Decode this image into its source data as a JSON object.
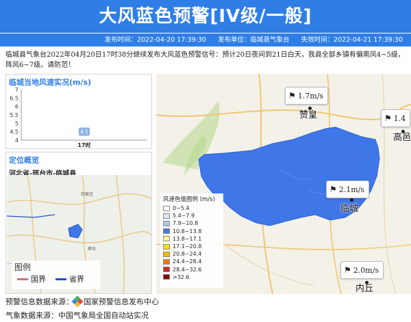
{
  "banner": {
    "title": "大风蓝色预警[IV级/一般]"
  },
  "meta": {
    "publish_label": "发布时间：",
    "publish_time": "2022-04-20 17:39:30",
    "unit_label": "发布单位：",
    "unit": "临城县气象台",
    "expire_label": "失效时间：",
    "expire_time": "2022-04-21 17:39:30"
  },
  "description": "临城县气象台2022年04月20日17时38分继续发布大风蓝色预警信号：预计20日夜间到21日白天，我县全部乡镇有偏南风4~5级，阵风6~7级。请防范！",
  "wind_panel": {
    "title": "临城当地风速实况(m/s)"
  },
  "chart_data": {
    "type": "bar",
    "title": "临城当地风速实况(m/s)",
    "categories": [
      "17时"
    ],
    "values": [
      4.5
    ],
    "value_labels": [
      "4.5"
    ],
    "ylim": [
      4,
      7
    ],
    "yticks": [
      "7",
      "6.5",
      "6",
      "5.5",
      "5",
      "4.5",
      "4"
    ],
    "color": "#8ab0e6"
  },
  "location_panel": {
    "title": "定位概览",
    "path": "河北省-邢台市-临城县",
    "legend_title": "图例",
    "legend_items": [
      {
        "label": "国界",
        "color": "#d07080"
      },
      {
        "label": "省界",
        "color": "#1f4fd1"
      }
    ],
    "map_labels": [
      "石家庄",
      "邢台"
    ]
  },
  "main_map": {
    "region_color": "#3f77e8",
    "stations": [
      {
        "speed": "1.7m/s",
        "name": "赞皇"
      },
      {
        "speed": "1.4",
        "name": "高邑"
      },
      {
        "speed": "2.1m/s",
        "name": "临城"
      },
      {
        "speed": "2.0m/s",
        "name": "内丘"
      }
    ],
    "legend": {
      "title": "风速色值图例 (m/s)",
      "items": [
        {
          "label": "0~5.4",
          "color": "#ffffff"
        },
        {
          "label": "5.4~7.9",
          "color": "#d6e6fb"
        },
        {
          "label": "7.9~10.8",
          "color": "#a9c9f4"
        },
        {
          "label": "10.8~13.8",
          "color": "#3f77e8"
        },
        {
          "label": "13.8~17.1",
          "color": "#fff59a"
        },
        {
          "label": "17.1~20.8",
          "color": "#ffdd00"
        },
        {
          "label": "20.8~24.4",
          "color": "#f6b800"
        },
        {
          "label": "24.4~28.4",
          "color": "#f07a00"
        },
        {
          "label": "28.4~32.6",
          "color": "#d22a1a"
        },
        {
          "label": ">32.6",
          "color": "#8b0000"
        }
      ]
    }
  },
  "footer": {
    "warning_source_label": "预警信息数据来源：",
    "warning_source": "国家预警信息发布中心",
    "weather_source_label": "气象数据来源：",
    "weather_source": "中国气象局全国自动站实况"
  }
}
